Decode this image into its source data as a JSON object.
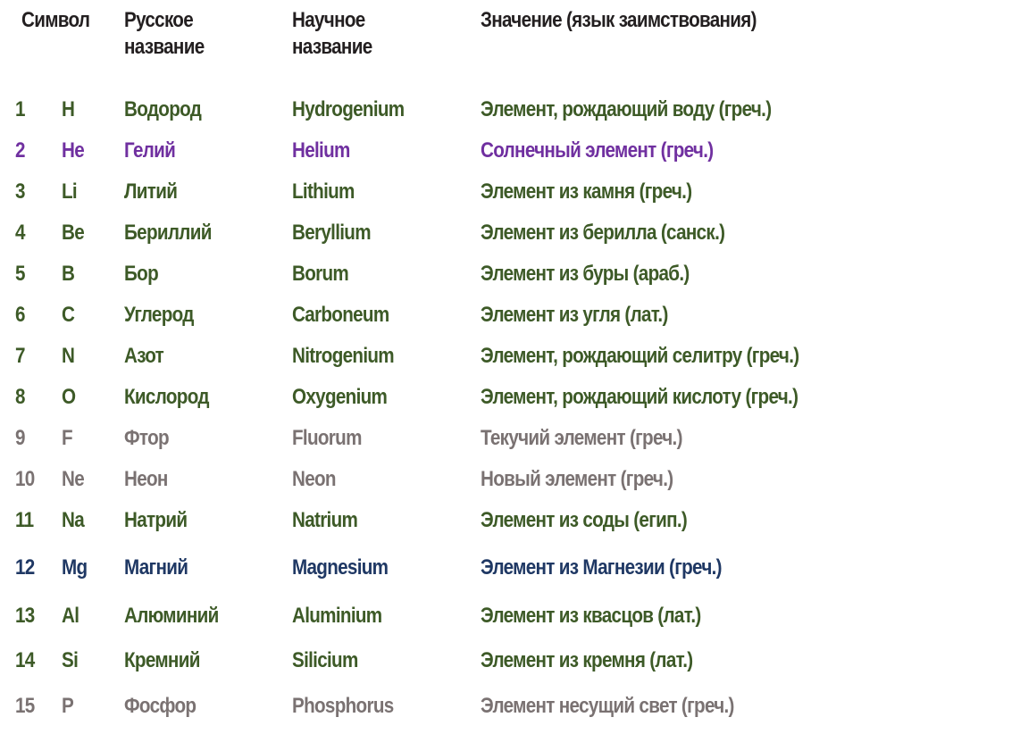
{
  "colors": {
    "header": "#231f20",
    "green": "#3d5a27",
    "purple": "#7030a0",
    "gray": "#7a7272",
    "navy": "#1f3864"
  },
  "header": {
    "symbol": "Символ",
    "russian_name_line1": "Русское",
    "russian_name_line2": "название",
    "scientific_name_line1": "Научное",
    "scientific_name_line2": "название",
    "meaning": "Значение (язык заимствования)"
  },
  "rows": [
    {
      "number": "1",
      "symbol": "H",
      "russian": "Водород",
      "scientific": "Hydrogenium",
      "meaning": "Элемент, рождающий воду (греч.)",
      "color": "#3d5a27"
    },
    {
      "number": "2",
      "symbol": "He",
      "russian": "Гелий",
      "scientific": "Helium",
      "meaning": "Солнечный элемент (греч.)",
      "color": "#7030a0"
    },
    {
      "number": "3",
      "symbol": "Li",
      "russian": "Литий",
      "scientific": "Lithium",
      "meaning": "Элемент из камня (греч.)",
      "color": "#3d5a27"
    },
    {
      "number": "4",
      "symbol": "Be",
      "russian": "Бериллий",
      "scientific": "Beryllium",
      "meaning": "Элемент из берилла (санск.)",
      "color": "#3d5a27"
    },
    {
      "number": "5",
      "symbol": "B",
      "russian": "Бор",
      "scientific": "Borum",
      "meaning": "Элемент из буры (араб.)",
      "color": "#3d5a27"
    },
    {
      "number": "6",
      "symbol": "C",
      "russian": "Углерод",
      "scientific": "Carboneum",
      "meaning": "Элемент из угля (лат.)",
      "color": "#3d5a27"
    },
    {
      "number": "7",
      "symbol": "N",
      "russian": "Азот",
      "scientific": "Nitrogenium",
      "meaning": "Элемент, рождающий селитру (греч.)",
      "color": "#3d5a27"
    },
    {
      "number": "8",
      "symbol": "O",
      "russian": "Кислород",
      "scientific": "Oxygenium",
      "meaning": "Элемент, рождающий кислоту (греч.)",
      "color": "#3d5a27"
    },
    {
      "number": "9",
      "symbol": "F",
      "russian": "Фтор",
      "scientific": "Fluorum",
      "meaning": "Текучий элемент (греч.)",
      "color": "#7a7272"
    },
    {
      "number": "10",
      "symbol": "Ne",
      "russian": "Неон",
      "scientific": "Neon",
      "meaning": "Новый элемент (греч.)",
      "color": "#7a7272"
    },
    {
      "number": "11",
      "symbol": "Na",
      "russian": "Натрий",
      "scientific": "Natrium",
      "meaning": "Элемент из соды (егип.)",
      "color": "#3d5a27"
    },
    {
      "number": "12",
      "symbol": "Mg",
      "russian": "Магний",
      "scientific": "Magnesium",
      "meaning": "Элемент из Магнезии (греч.)",
      "color": "#1f3864"
    },
    {
      "number": "13",
      "symbol": "Al",
      "russian": "Алюминий",
      "scientific": "Aluminium",
      "meaning": "Элемент из квасцов (лат.)",
      "color": "#3d5a27"
    },
    {
      "number": "14",
      "symbol": "Si",
      "russian": "Кремний",
      "scientific": "Silicium",
      "meaning": "Элемент из кремня (лат.)",
      "color": "#3d5a27"
    },
    {
      "number": "15",
      "symbol": "P",
      "russian": "Фосфор",
      "scientific": "Phosphorus",
      "meaning": "Элемент несущий свет (греч.)",
      "color": "#7a7272"
    }
  ]
}
